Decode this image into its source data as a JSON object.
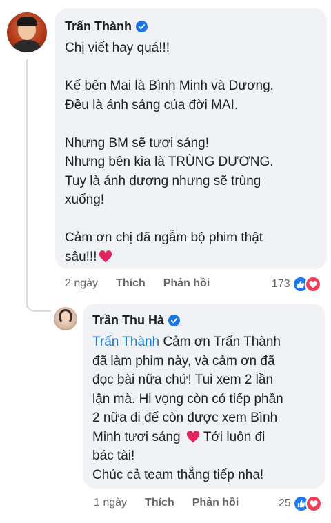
{
  "main_comment": {
    "author": "Trấn Thành",
    "lines": [
      "Chị viết hay quá!!!",
      "",
      "Kế bên Mai là Bình Minh và Dương.",
      "Đều là ánh sáng của đời MAI.",
      "",
      "Nhưng BM sẽ tươi sáng!",
      "Nhưng bên kia là TRÙNG DƯƠNG.",
      "Tuy là ánh dương nhưng sẽ trùng",
      "xuống!",
      "",
      "Cảm ơn chị đã ngẫm bộ phim thật",
      "sâu!!!"
    ],
    "time": "2 ngày",
    "like_label": "Thích",
    "reply_label": "Phản hồi",
    "reaction_count": "173"
  },
  "reply_comment": {
    "author": "Trần Thu Hà",
    "mention": "Trấn Thành",
    "line1_rest": " Cảm ơn Trấn Thành",
    "lines": [
      "đã làm phim này, và cảm ơn đã",
      "đọc bài nữa chứ! Tui xem 2 lần",
      "lận mà. Hi vọng còn có tiếp phần",
      "2 nữa đi để còn được xem Bình"
    ],
    "line6_before": "Minh tươi sáng ",
    "line6_after": " Tới luôn đi",
    "lines_end": [
      "bác tài!",
      "Chúc cả team thắng tiếp nha!"
    ],
    "time": "1 ngày",
    "like_label": "Thích",
    "reply_label": "Phản hồi",
    "reaction_count": "25"
  },
  "icons": {
    "verified": "verified-badge-icon",
    "like": "like-reaction-icon",
    "love": "love-reaction-icon",
    "heart": "red-heart-emoji"
  },
  "colors": {
    "bubble": "#f0f2f5",
    "mention": "#1876d2",
    "verified": "#1b74e4",
    "meta_text": "#65676b",
    "heart": "#e0245e"
  }
}
